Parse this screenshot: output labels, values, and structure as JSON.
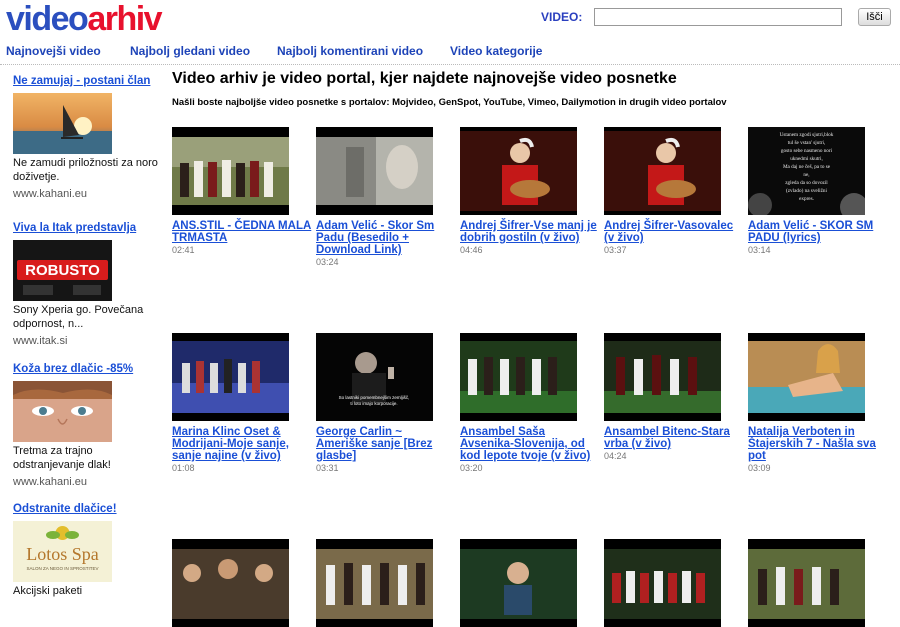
{
  "header": {
    "logo_part1": "video",
    "logo_part2": "arhiv",
    "search_label": "VIDEO:",
    "search_value": "",
    "search_button": "Išči"
  },
  "nav": [
    {
      "label": "Najnovejši video"
    },
    {
      "label": "Najbolj gledani video"
    },
    {
      "label": "Najbolj komentirani video"
    },
    {
      "label": "Video kategorije"
    }
  ],
  "sidebar": {
    "ads": [
      {
        "title": "Ne zamujaj - postani član",
        "text": "Ne zamudi priložnosti za noro doživetje.",
        "url": "www.kahani.eu",
        "image": "windsurfer"
      },
      {
        "title": "Viva la Itak predstavlja",
        "text": "Sony Xperia go. Povečana odpornost, n...",
        "url": "www.itak.si",
        "image": "robusto"
      },
      {
        "title": "Koža brez dlačic -85%",
        "text": "Tretma za trajno odstranjevanje dlak!",
        "url": "www.kahani.eu",
        "image": "woman-eyes"
      },
      {
        "title": "Odstranite dlačice!",
        "text": "Akcijski paketi",
        "url": "",
        "image": "lotos-spa",
        "logo_text": "Lotos Spa",
        "logo_sub": "SALON ZA NEGO IN SPROSTITEV"
      }
    ]
  },
  "main": {
    "title": "Video arhiv je video portal, kjer najdete najnovejše video posnetke",
    "subtitle": "Našli boste najboljše video posnetke s portalov: Mojvideo, GenSpot, YouTube, Vimeo, Dailymotion in drugih video portalov",
    "rows": [
      [
        {
          "title": "ANS.STIL - ČEDNA MALA TRMASTA",
          "duration": "02:41",
          "thumb": "folk-band"
        },
        {
          "title": "Adam Velić - Skor Sm Padu (Besedilo + Download Link)",
          "duration": "03:24",
          "thumb": "grey-face"
        },
        {
          "title": "Andrej Šifrer-Vse manj je dobrih gostiln (v živo)",
          "duration": "04:46",
          "thumb": "guitarist"
        },
        {
          "title": "Andrej Šifrer-Vasovalec (v živo)",
          "duration": "03:37",
          "thumb": "guitarist"
        },
        {
          "title": "Adam Velić - SKOR SM PADU (lyrics)",
          "duration": "03:14",
          "thumb": "lyrics",
          "thumb_text": [
            "Ustanem zgodi sjutri,blok",
            "tul še vstan' sjutri,",
            "gosto sebe nasmeno nori",
            "uknedmi skutri,",
            "Ma daj ne češ, pa to se",
            "ne,",
            "zgleda da so dovozil",
            "(zvlado) na sveližni",
            "expres."
          ]
        }
      ],
      [
        {
          "title": "Marina Klinc Oset & Modrijani-Moje sanje, sanje najine (v živo)",
          "duration": "01:08",
          "thumb": "stage-blue"
        },
        {
          "title": "George Carlin ~ Ameriške sanje [Brez glasbe]",
          "duration": "03:31",
          "thumb": "comedian",
          "thumb_text": [
            "So lastniki pomembnejšim zemljišč,",
            "ti loto imajo korporacije."
          ]
        },
        {
          "title": "Ansambel Saša Avsenika-Slovenija, od kod lepote tvoje (v živo)",
          "duration": "03:20",
          "thumb": "folk-green"
        },
        {
          "title": "Ansambel Bitenc-Stara vrba (v živo)",
          "duration": "04:24",
          "thumb": "folk-green"
        },
        {
          "title": "Natalija Verboten in Štajerskih 7 - Našla sva pot",
          "duration": "03:09",
          "thumb": "pool"
        }
      ],
      [
        {
          "title": "",
          "duration": "",
          "thumb": "crowd"
        },
        {
          "title": "",
          "duration": "",
          "thumb": "folk-hall"
        },
        {
          "title": "",
          "duration": "",
          "thumb": "singer"
        },
        {
          "title": "",
          "duration": "",
          "thumb": "stage-red"
        },
        {
          "title": "",
          "duration": "",
          "thumb": "folk-band"
        }
      ]
    ]
  }
}
